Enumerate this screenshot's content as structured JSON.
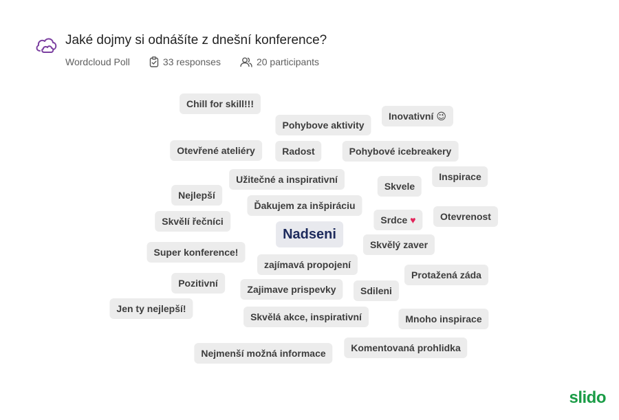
{
  "header": {
    "title": "Jaké dojmy si odnášíte z dnešní konference?",
    "poll_type": "Wordcloud Poll",
    "responses": "33 responses",
    "participants": "20 participants"
  },
  "words": [
    "Chill for skill!!!",
    "Pohybove aktivity",
    "Inovativní",
    "Otevřené ateliéry",
    "Radost",
    "Pohybové icebreakery",
    "Užitečné a inspirativní",
    "Skvele",
    "Inspirace",
    "Nejlepší",
    "Ďakujem za inšpiráciu",
    "Srdce",
    "Otevrenost",
    "Skvělí řečníci",
    "Nadseni",
    "Skvělý zaver",
    "Super konference!",
    "zajímavá propojení",
    "Protažená záda",
    "Pozitivní",
    "Zajimave prispevky",
    "Sdileni",
    "Jen ty nejlepší!",
    "Skvělá akce, inspirativní",
    "Mnoho inspirace",
    "Komentovaná prohlidka",
    "Nejmenší možná informace"
  ],
  "emojis": {
    "inovativni": "😉",
    "srdce": "♥"
  },
  "logo": "slido",
  "colors": {
    "accent": "#1a9c46",
    "icon": "#7b3fa0",
    "highlight_word": "#1d2a5c",
    "chip_bg": "#ececec"
  }
}
